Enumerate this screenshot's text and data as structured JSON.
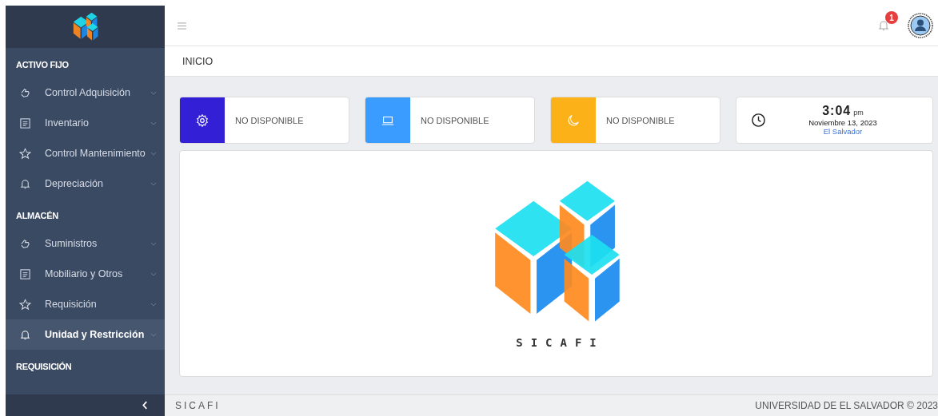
{
  "sidebar": {
    "sections": [
      {
        "title": "ACTIVO FIJO",
        "items": [
          {
            "label": "Control Adquisición",
            "kind": "hand",
            "selected": false
          },
          {
            "label": "Inventario",
            "kind": "list",
            "selected": false
          },
          {
            "label": "Control Mantenimiento",
            "kind": "star",
            "selected": false
          },
          {
            "label": "Depreciación",
            "kind": "bell",
            "selected": false
          }
        ]
      },
      {
        "title": "ALMACÉN",
        "items": [
          {
            "label": "Suministros",
            "kind": "hand",
            "selected": false
          },
          {
            "label": "Mobiliario y Otros",
            "kind": "list",
            "selected": false
          },
          {
            "label": "Requisición",
            "kind": "star",
            "selected": false
          },
          {
            "label": "Unidad y Restricción",
            "kind": "bell",
            "selected": true
          }
        ]
      },
      {
        "title": "REQUISICIÓN"
      }
    ]
  },
  "header": {
    "notifications": "1"
  },
  "breadcrumb": "INICIO",
  "cards": [
    {
      "kind": "gear",
      "color": "#3320d6",
      "label": "NO DISPONIBLE"
    },
    {
      "kind": "laptop",
      "color": "#3a9cff",
      "label": "NO DISPONIBLE"
    },
    {
      "kind": "moon",
      "color": "#fbb117",
      "label": "NO DISPONIBLE"
    }
  ],
  "clock": {
    "time": "3:04",
    "ampm": "pm",
    "date": "Noviembre 13, 2023",
    "place": "El Salvador"
  },
  "logo_text": "SICAFI",
  "footer": {
    "left": "SICAFI",
    "right": "UNIVERSIDAD DE EL SALVADOR © 2023"
  }
}
